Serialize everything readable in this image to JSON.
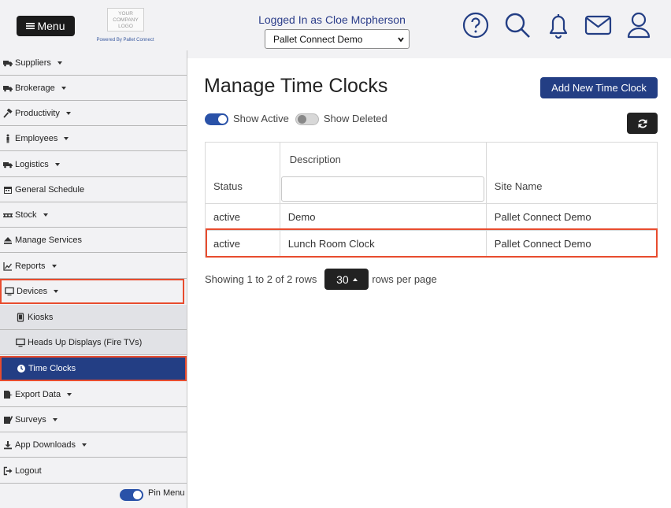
{
  "header": {
    "menu_label": "Menu",
    "logo_text": "YOUR COMPANY LOGO",
    "logo_sub": "Powered By Pallet Connect",
    "logged_in": "Logged In as Cloe Mcpherson",
    "site_selected": "Pallet Connect Demo",
    "icons": [
      "help-icon",
      "search-icon",
      "bell-icon",
      "mail-icon",
      "user-icon"
    ],
    "icon_color": "#233e84"
  },
  "sidebar": {
    "items": [
      {
        "label": "Suppliers",
        "icon": "truck-icon"
      },
      {
        "label": "Brokerage",
        "icon": "truck-icon"
      },
      {
        "label": "Productivity",
        "icon": "hammer-icon"
      },
      {
        "label": "Employees",
        "icon": "person-icon"
      },
      {
        "label": "Logistics",
        "icon": "truck-icon"
      },
      {
        "label": "General Schedule",
        "icon": "calendar-icon"
      },
      {
        "label": "Stock",
        "icon": "pallet-icon"
      },
      {
        "label": "Manage Services",
        "icon": "eject-icon"
      },
      {
        "label": "Reports",
        "icon": "chart-icon"
      },
      {
        "label": "Devices",
        "icon": "monitor-icon"
      },
      {
        "label": "Kiosks",
        "icon": "tablet-icon"
      },
      {
        "label": "Heads Up Displays (Fire TVs)",
        "icon": "monitor-icon"
      },
      {
        "label": "Time Clocks",
        "icon": "clock-icon"
      },
      {
        "label": "Export Data",
        "icon": "export-icon"
      },
      {
        "label": "Surveys",
        "icon": "survey-icon"
      },
      {
        "label": "App Downloads",
        "icon": "download-icon"
      },
      {
        "label": "Logout",
        "icon": "logout-icon"
      }
    ],
    "pin_label": "Pin Menu",
    "active_color": "#233e84",
    "highlight_color": "#e84c2e"
  },
  "main": {
    "title": "Manage Time Clocks",
    "add_button": "Add New Time Clock",
    "show_active": "Show Active",
    "show_deleted": "Show Deleted",
    "columns": {
      "status": "Status",
      "description": "Description",
      "site": "Site Name"
    },
    "rows": [
      {
        "status": "active",
        "description": "Demo",
        "site": "Pallet Connect Demo"
      },
      {
        "status": "active",
        "description": "Lunch Room Clock",
        "site": "Pallet Connect Demo"
      }
    ],
    "pager": {
      "showing": "Showing 1 to 2 of 2 rows",
      "page_size": "30",
      "suffix": "rows per page"
    }
  }
}
